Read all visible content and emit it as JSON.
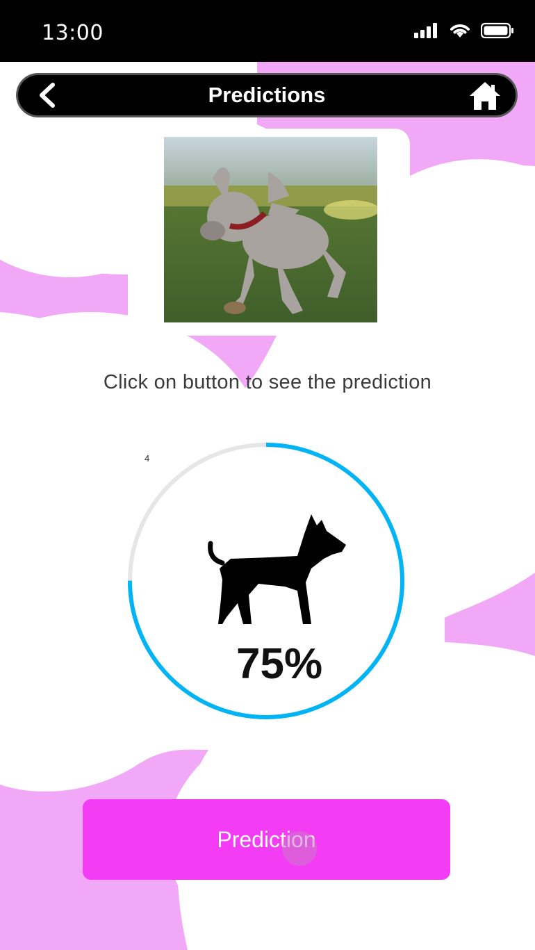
{
  "status": {
    "time": "13:00"
  },
  "header": {
    "title": "Predictions"
  },
  "instruction": "Click on button to see the prediction",
  "gauge": {
    "small_label": "4",
    "percent_text": "75%",
    "progress": 0.75,
    "accent": "#00b4f5",
    "track": "#e6e6e6"
  },
  "button": {
    "label": "Prediction",
    "color": "#f53cf5"
  },
  "colors": {
    "blob": "#f1a8f6",
    "header_bg": "#000000"
  }
}
